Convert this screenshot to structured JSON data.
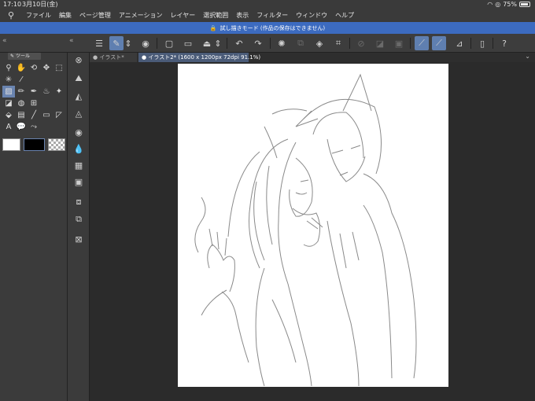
{
  "status": {
    "time": "17:10",
    "date": "3月10日(金)",
    "battery": "75%"
  },
  "menu": [
    "ファイル",
    "編集",
    "ページ管理",
    "アニメーション",
    "レイヤー",
    "選択範囲",
    "表示",
    "フィルター",
    "ウィンドウ",
    "ヘルプ"
  ],
  "banner": {
    "text": "試し描きモード (作品の保存はできません)"
  },
  "tools_tab": "ツール",
  "tabs": [
    {
      "label": "イラスト*"
    },
    {
      "label": "イラスト2* (1600 x 1200px 72dpi 91.1%)"
    }
  ],
  "colors": {
    "accent": "#3c6bc0",
    "active_tool": "#6a84b0",
    "panel": "#3b3b3b",
    "canvas_bg": "#2b2b2b"
  }
}
